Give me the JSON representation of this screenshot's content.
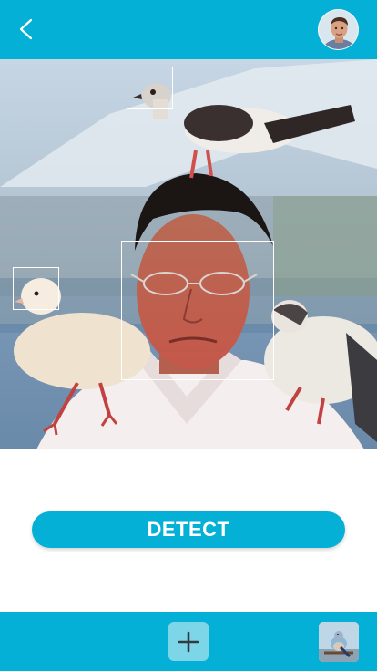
{
  "header": {
    "back_icon": "chevron-left-icon",
    "avatar_icon": "user-avatar"
  },
  "photo": {
    "description_icon": "photo-man-with-pigeons",
    "detections": [
      {
        "label": "bird-detection-top"
      },
      {
        "label": "face-detection"
      },
      {
        "label": "bird-detection-left"
      }
    ]
  },
  "actions": {
    "detect_label": "DETECT"
  },
  "footer": {
    "add_icon": "plus-icon",
    "gallery_icon": "bird-thumbnail"
  },
  "colors": {
    "accent": "#05b0d6",
    "add_button": "#7dd5e8",
    "box_stroke": "#ffffff"
  }
}
